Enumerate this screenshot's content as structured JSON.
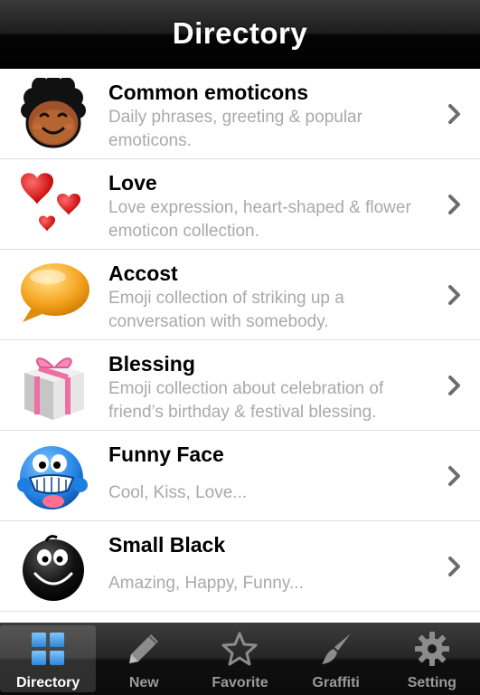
{
  "header": {
    "title": "Directory"
  },
  "list": [
    {
      "title": "Common emoticons",
      "desc": "Daily phrases, greeting & popular emoticons.",
      "icon": "afro-face-icon"
    },
    {
      "title": "Love",
      "desc": "Love expression, heart-shaped & flower emoticon collection.",
      "icon": "hearts-icon"
    },
    {
      "title": "Accost",
      "desc": "Emoji collection of striking up a conversation with somebody.",
      "icon": "speech-bubble-icon"
    },
    {
      "title": "Blessing",
      "desc": "Emoji collection about celebration of friend’s birthday & festival blessing.",
      "icon": "gift-box-icon"
    },
    {
      "title": "Funny Face",
      "desc": "Cool, Kiss, Love...",
      "icon": "blue-face-icon"
    },
    {
      "title": "Small Black",
      "desc": "Amazing, Happy, Funny...",
      "icon": "black-face-icon"
    }
  ],
  "tabs": [
    {
      "label": "Directory",
      "icon": "grid-icon",
      "active": true
    },
    {
      "label": "New",
      "icon": "pencil-icon",
      "active": false
    },
    {
      "label": "Favorite",
      "icon": "star-icon",
      "active": false
    },
    {
      "label": "Graffiti",
      "icon": "brush-icon",
      "active": false
    },
    {
      "label": "Setting",
      "icon": "gear-icon",
      "active": false
    }
  ],
  "colors": {
    "accent": "#4aa3e8",
    "secondary_text": "#a9a9a9",
    "tab_inactive": "#9a9a9a"
  }
}
